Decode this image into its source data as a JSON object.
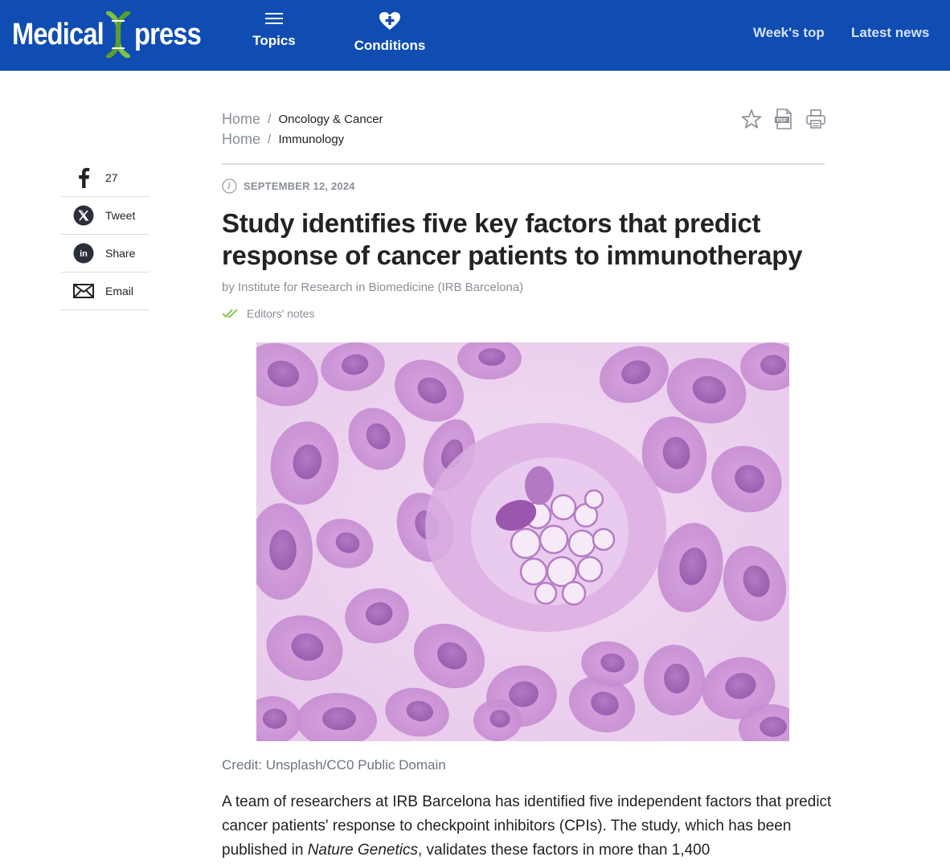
{
  "header": {
    "logo_left": "Medical",
    "logo_right": "press",
    "nav": {
      "topics": "Topics",
      "conditions": "Conditions",
      "weeks_top": "Week's top",
      "latest_news": "Latest news"
    }
  },
  "social": {
    "facebook_count": "27",
    "tweet": "Tweet",
    "share": "Share",
    "email": "Email"
  },
  "breadcrumbs": [
    {
      "home": "Home",
      "sep": "/",
      "category": "Oncology & Cancer"
    },
    {
      "home": "Home",
      "sep": "/",
      "category": "Immunology"
    }
  ],
  "article": {
    "date": "SEPTEMBER 12, 2024",
    "title": "Study identifies five key factors that predict response of cancer patients to immunotherapy",
    "byline": "by Institute for Research in Biomedicine (IRB Barcelona)",
    "editors_notes": "Editors' notes",
    "image_credit": "Credit: Unsplash/CC0 Public Domain",
    "body_part1": "A team of researchers at IRB Barcelona has identified five independent factors that predict cancer patients' response to checkpoint inhibitors (CPIs). The study, which has been published in ",
    "body_journal": "Nature Genetics",
    "body_part2": ", validates these factors in more than 1,400"
  },
  "colors": {
    "brand_blue": "#0f4db3",
    "helix_green": "#7cc242",
    "cell_purple": "#b77cc8"
  },
  "icons": [
    "hamburger-icon",
    "heart-plus-icon",
    "facebook-icon",
    "x-icon",
    "linkedin-icon",
    "email-icon",
    "star-icon",
    "pdf-icon",
    "print-icon",
    "clock-icon",
    "double-check-icon"
  ]
}
